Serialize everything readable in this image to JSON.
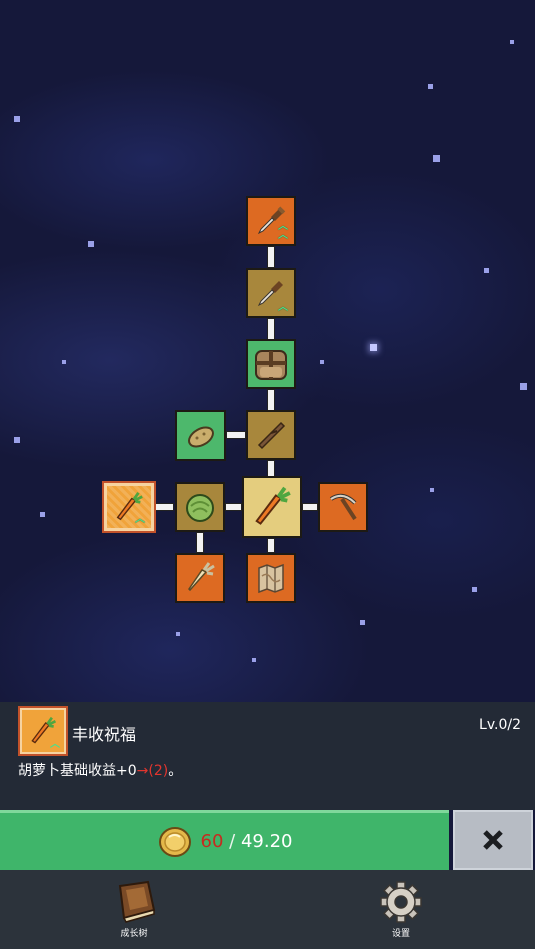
{
  "skill_tree": {
    "nodes": [
      {
        "id": "shovel-upgrade",
        "color": "orange",
        "icon": "shovel-icon",
        "upgrade_badge": true
      },
      {
        "id": "shovel",
        "color": "brown",
        "icon": "shovel-icon",
        "upgrade_badge": true
      },
      {
        "id": "backpack",
        "color": "green",
        "icon": "backpack-icon",
        "upgrade_badge": false
      },
      {
        "id": "sweet-potato",
        "color": "green",
        "icon": "potato-icon",
        "upgrade_badge": false
      },
      {
        "id": "stick",
        "color": "brown",
        "icon": "stick-icon",
        "upgrade_badge": false
      },
      {
        "id": "carrot-blessing",
        "color": "orange",
        "icon": "carrot-icon",
        "upgrade_badge": true,
        "selected": true
      },
      {
        "id": "cabbage",
        "color": "brown",
        "icon": "cabbage-icon",
        "upgrade_badge": false
      },
      {
        "id": "carrot-center",
        "color": "brown",
        "icon": "carrot-icon",
        "upgrade_badge": false
      },
      {
        "id": "pickaxe",
        "color": "orange",
        "icon": "pickaxe-icon",
        "upgrade_badge": false
      },
      {
        "id": "parsnip",
        "color": "orange",
        "icon": "parsnip-icon",
        "upgrade_badge": false
      },
      {
        "id": "map",
        "color": "orange",
        "icon": "map-icon",
        "upgrade_badge": false
      }
    ]
  },
  "info": {
    "title": "丰收祝福",
    "level": "Lv.0/2",
    "desc_prefix": "胡萝卜基础收益+0",
    "desc_arrow": "→",
    "desc_next": "(2)",
    "desc_suffix": "。"
  },
  "upgrade": {
    "cost": "60",
    "separator": " / ",
    "balance": "49.20"
  },
  "nav": {
    "growth_tree": "成长树",
    "settings": "设置"
  },
  "colors": {
    "orange_node": "#dd6a22",
    "brown_node": "#a8873c",
    "green_node": "#4db86c",
    "upgrade_button": "#3fb56a",
    "cost_insufficient": "#c62b1f",
    "close_button": "#b7bcc4"
  }
}
